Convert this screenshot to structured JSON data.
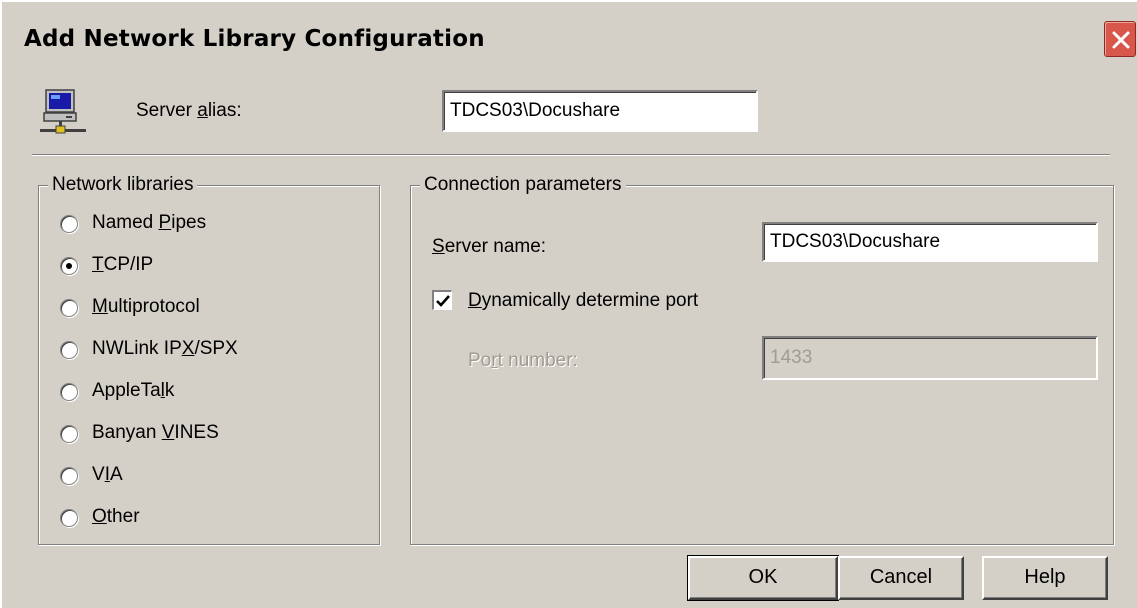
{
  "window": {
    "title": "Add Network Library Configuration",
    "close_label": "✕"
  },
  "alias": {
    "label_pre": "Server ",
    "label_key": "a",
    "label_post": "lias:",
    "value": "TDCS03\\Docushare"
  },
  "network_libraries": {
    "title": "Network libraries",
    "selected": "TCP/IP",
    "items": [
      {
        "pre": "Named ",
        "key": "P",
        "post": "ipes",
        "selected": false
      },
      {
        "pre": "",
        "key": "T",
        "post": "CP/IP",
        "selected": true
      },
      {
        "pre": "",
        "key": "M",
        "post": "ultiprotocol",
        "selected": false
      },
      {
        "pre": "NWLink IP",
        "key": "X",
        "post": "/SPX",
        "selected": false
      },
      {
        "pre": "AppleTa",
        "key": "l",
        "post": "k",
        "selected": false
      },
      {
        "pre": "Banyan ",
        "key": "V",
        "post": "INES",
        "selected": false
      },
      {
        "pre": "V",
        "key": "I",
        "post": "A",
        "selected": false
      },
      {
        "pre": "",
        "key": "O",
        "post": "ther",
        "selected": false
      }
    ]
  },
  "connection": {
    "title": "Connection parameters",
    "server_name": {
      "pre": "",
      "key": "S",
      "post": "erver name:",
      "value": "TDCS03\\Docushare"
    },
    "dynamic_port": {
      "pre": "",
      "key": "D",
      "post": "ynamically determine port",
      "checked": true
    },
    "port_number": {
      "pre": "Po",
      "key": "r",
      "post": "t number:",
      "value": "1433",
      "enabled": false
    }
  },
  "buttons": {
    "ok": "OK",
    "cancel": "Cancel",
    "help": "Help"
  }
}
